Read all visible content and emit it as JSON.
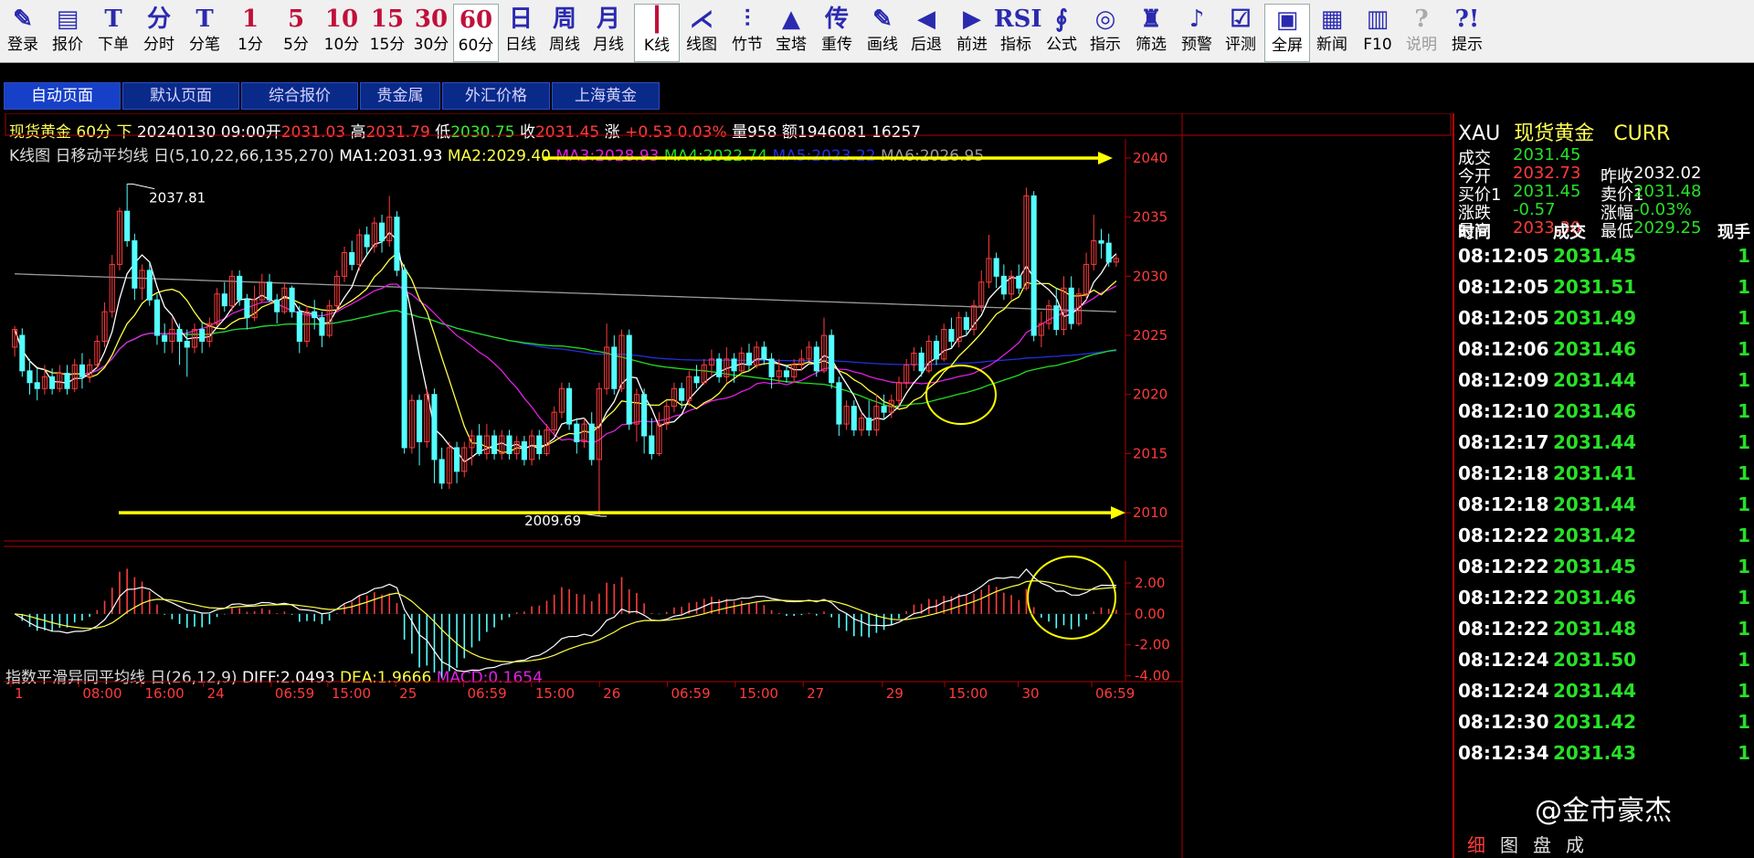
{
  "toolbar": [
    {
      "icon": "✎",
      "label": "登录",
      "name": "login"
    },
    {
      "icon": "▤",
      "label": "报价",
      "name": "quote"
    },
    {
      "icon": "T",
      "label": "下单",
      "name": "order"
    },
    {
      "icon": "分",
      "label": "分时",
      "name": "timeshare"
    },
    {
      "icon": "T",
      "label": "分笔",
      "name": "tick"
    },
    {
      "icon": "1",
      "label": "1分",
      "name": "1min"
    },
    {
      "icon": "5",
      "label": "5分",
      "name": "5min"
    },
    {
      "icon": "10",
      "label": "10分",
      "name": "10min"
    },
    {
      "icon": "15",
      "label": "15分",
      "name": "15min"
    },
    {
      "icon": "30",
      "label": "30分",
      "name": "30min"
    },
    {
      "icon": "60",
      "label": "60分",
      "name": "60min"
    },
    {
      "icon": "日",
      "label": "日线",
      "name": "daily"
    },
    {
      "icon": "周",
      "label": "周线",
      "name": "weekly"
    },
    {
      "icon": "月",
      "label": "月线",
      "name": "monthly"
    },
    {
      "icon": "┃",
      "label": "K线",
      "name": "kline"
    },
    {
      "icon": "⋌",
      "label": "线图",
      "name": "line"
    },
    {
      "icon": "⫶",
      "label": "竹节",
      "name": "bamboo"
    },
    {
      "icon": "▲",
      "label": "宝塔",
      "name": "tower"
    },
    {
      "icon": "传",
      "label": "重传",
      "name": "resend"
    },
    {
      "icon": "✎",
      "label": "画线",
      "name": "draw"
    },
    {
      "icon": "◀",
      "label": "后退",
      "name": "back"
    },
    {
      "icon": "▶",
      "label": "前进",
      "name": "forward"
    },
    {
      "icon": "RSI",
      "label": "指标",
      "name": "indicator"
    },
    {
      "icon": "∮",
      "label": "公式",
      "name": "formula"
    },
    {
      "icon": "◎",
      "label": "指示",
      "name": "indicate"
    },
    {
      "icon": "♜",
      "label": "筛选",
      "name": "filter"
    },
    {
      "icon": "♪",
      "label": "预警",
      "name": "alert"
    },
    {
      "icon": "☑",
      "label": "评测",
      "name": "evaluate"
    },
    {
      "icon": "▣",
      "label": "全屏",
      "name": "fullscreen"
    },
    {
      "icon": "▦",
      "label": "新闻",
      "name": "news"
    },
    {
      "icon": "▥",
      "label": "F10",
      "name": "f10"
    },
    {
      "icon": "?",
      "label": "说明",
      "name": "explain"
    },
    {
      "icon": "?!",
      "label": "提示",
      "name": "tips"
    }
  ],
  "tabs": [
    "自动页面",
    "默认页面",
    "综合报价",
    "贵金属",
    "外汇价格",
    "上海黄金"
  ],
  "header": {
    "name": "现货黄金",
    "period": "60分",
    "dir": "下",
    "date": "20240130 09:00",
    "open_label": "开",
    "open": "2031.03",
    "high_label": "高",
    "high": "2031.79",
    "low_label": "低",
    "low": "2030.75",
    "close_label": "收",
    "close": "2031.45",
    "chg_label": "涨",
    "chg": "+0.53",
    "pct": "0.03%",
    "vol_label": "量",
    "vol": "958",
    "amt_label": "额",
    "amt": "1946081",
    "oi": "16257"
  },
  "ma_bar": {
    "title": "K线图 日移动平均线 日(5,10,22,66,135,270)",
    "ma1": "MA1:2031.93",
    "ma2": "MA2:2029.40",
    "ma3": "MA3:2028.93",
    "ma4": "MA4:2022.74",
    "ma5": "MA5:2023.22",
    "ma6": "MA6:2026.95"
  },
  "macd_bar": {
    "title": "指数平滑异同平均线 日(26,12,9)",
    "diff": "DIFF:2.0493",
    "dea": "DEA:1.9666",
    "macd": "MACD:0.1654"
  },
  "colors": {
    "up": "#ff3b3b",
    "down": "#54ffff",
    "ma1": "#ffffff",
    "ma2": "#ffff44",
    "ma3": "#e020e0",
    "ma4": "#22dd22",
    "ma5": "#2030e0",
    "ma6": "#9a9a9a",
    "arrow": "#ffff00",
    "grid": "#b00000"
  },
  "chart_data": {
    "type": "candlestick",
    "y_ticks": [
      "2040",
      "2035",
      "2030",
      "2025",
      "2020",
      "2015",
      "2010"
    ],
    "ylim": [
      2008,
      2041
    ],
    "x_ticks": [
      "1",
      "08:00",
      "16:00",
      "24",
      "06:59",
      "15:00",
      "25",
      "06:59",
      "15:00",
      "26",
      "06:59",
      "15:00",
      "27",
      "29",
      "15:00",
      "30",
      "06:59"
    ],
    "macd_ticks": [
      "2.00",
      "0.00",
      "-2.00",
      "-4.00"
    ],
    "macd_ylim": [
      -4.2,
      3.3
    ],
    "annotations": {
      "high_marker": "2037.81",
      "low_marker": "2009.69",
      "arrow_levels": [
        2040,
        2010
      ]
    },
    "candles": [
      [
        2024,
        2025.5,
        2023.2,
        2025.8
      ],
      [
        2025,
        2022,
        2021.5,
        2025.6
      ],
      [
        2022,
        2021,
        2020,
        2023
      ],
      [
        2021,
        2020.5,
        2019.5,
        2022.2
      ],
      [
        2020.5,
        2021.5,
        2020,
        2022.5
      ],
      [
        2021.5,
        2020.5,
        2020,
        2022.2
      ],
      [
        2020.5,
        2021.8,
        2020.2,
        2022.5
      ],
      [
        2021.8,
        2020.5,
        2020,
        2022.5
      ],
      [
        2020.5,
        2022.5,
        2020.2,
        2023
      ],
      [
        2022.5,
        2021.5,
        2020.5,
        2023.5
      ],
      [
        2021.5,
        2022.5,
        2021,
        2023
      ],
      [
        2022.5,
        2024.5,
        2022.2,
        2025
      ],
      [
        2024.5,
        2027,
        2024,
        2027.8
      ],
      [
        2027,
        2031,
        2026.5,
        2031.8
      ],
      [
        2031,
        2035.5,
        2030.5,
        2035.8
      ],
      [
        2035.5,
        2033,
        2032.5,
        2037.8
      ],
      [
        2033,
        2029,
        2028,
        2033.6
      ],
      [
        2029,
        2030.5,
        2028,
        2031
      ],
      [
        2030.5,
        2028,
        2027.5,
        2031.2
      ],
      [
        2028,
        2025,
        2024.2,
        2028.5
      ],
      [
        2025,
        2024.5,
        2023.5,
        2026
      ],
      [
        2024.5,
        2025.5,
        2023.5,
        2026.5
      ],
      [
        2025.5,
        2024.5,
        2022.5,
        2026
      ],
      [
        2024.5,
        2024,
        2021.5,
        2025.5
      ],
      [
        2024,
        2025.5,
        2023.5,
        2026
      ],
      [
        2025.5,
        2024.5,
        2023.5,
        2026.2
      ],
      [
        2024.5,
        2026,
        2024,
        2026.5
      ],
      [
        2026,
        2028.5,
        2025.8,
        2029
      ],
      [
        2028.5,
        2027.5,
        2027,
        2029.5
      ],
      [
        2027.5,
        2030,
        2027,
        2030.5
      ],
      [
        2030,
        2028,
        2027.5,
        2030.5
      ],
      [
        2028,
        2026.5,
        2025.5,
        2028.5
      ],
      [
        2026.5,
        2028,
        2026.2,
        2029.2
      ],
      [
        2028,
        2029.5,
        2027.8,
        2030.2
      ],
      [
        2029.5,
        2028,
        2027.8,
        2030.2
      ],
      [
        2028,
        2027,
        2026,
        2028.5
      ],
      [
        2027,
        2029,
        2026.8,
        2029.5
      ],
      [
        2029,
        2027,
        2026.5,
        2029.2
      ],
      [
        2027,
        2024.5,
        2023.5,
        2027.5
      ],
      [
        2024.5,
        2027,
        2024,
        2027.5
      ],
      [
        2027,
        2026.5,
        2025.5,
        2028
      ],
      [
        2026.5,
        2025,
        2024,
        2027
      ],
      [
        2025,
        2027.5,
        2024.8,
        2028
      ],
      [
        2027.5,
        2030,
        2027,
        2030.5
      ],
      [
        2030,
        2032,
        2029.5,
        2032.5
      ],
      [
        2032,
        2031,
        2030.5,
        2033
      ],
      [
        2031,
        2033.5,
        2030.5,
        2034
      ],
      [
        2033.5,
        2032.5,
        2031.8,
        2034.2
      ],
      [
        2032.5,
        2034.5,
        2032,
        2035
      ],
      [
        2034.5,
        2033,
        2032,
        2035.2
      ],
      [
        2033,
        2035,
        2032.5,
        2036.8
      ],
      [
        2035,
        2030.5,
        2030,
        2035.5
      ],
      [
        2030.5,
        2015.5,
        2015,
        2031
      ],
      [
        2015.5,
        2019.5,
        2015,
        2020
      ],
      [
        2019.5,
        2016,
        2014,
        2020
      ],
      [
        2016,
        2020,
        2015.5,
        2020.5
      ],
      [
        2020,
        2014.5,
        2012.5,
        2020.5
      ],
      [
        2014.5,
        2012.5,
        2012,
        2015.5
      ],
      [
        2012.5,
        2015.5,
        2012,
        2016
      ],
      [
        2015.5,
        2013.5,
        2012.5,
        2016
      ],
      [
        2013.5,
        2015.5,
        2013,
        2016
      ],
      [
        2015.5,
        2016.5,
        2014,
        2017
      ],
      [
        2016.5,
        2015,
        2014.8,
        2017.5
      ],
      [
        2015,
        2016.5,
        2014.5,
        2017.5
      ],
      [
        2016.5,
        2015,
        2014.5,
        2017
      ],
      [
        2015,
        2016.5,
        2014.5,
        2017
      ],
      [
        2016.5,
        2015,
        2014.5,
        2017
      ],
      [
        2015,
        2016,
        2014.5,
        2016.5
      ],
      [
        2016,
        2014.5,
        2014,
        2016.5
      ],
      [
        2014.5,
        2016.5,
        2014,
        2017
      ],
      [
        2016.5,
        2015,
        2014.5,
        2017
      ],
      [
        2015,
        2017,
        2014.8,
        2017.5
      ],
      [
        2017,
        2018.5,
        2016.5,
        2019
      ],
      [
        2018.5,
        2020.5,
        2018,
        2021
      ],
      [
        2020.5,
        2017.5,
        2017,
        2021
      ],
      [
        2017.5,
        2016,
        2015,
        2018
      ],
      [
        2016,
        2017.5,
        2015.5,
        2018
      ],
      [
        2017.5,
        2014.5,
        2014,
        2018.5
      ],
      [
        2014.5,
        2020.5,
        2009.7,
        2021
      ],
      [
        2020.5,
        2024,
        2020,
        2026
      ],
      [
        2024,
        2020.5,
        2020,
        2025
      ],
      [
        2020.5,
        2025,
        2020.2,
        2025.5
      ],
      [
        2025,
        2017.5,
        2017,
        2025.5
      ],
      [
        2017.5,
        2020,
        2016,
        2020.5
      ],
      [
        2020,
        2016.5,
        2015,
        2020.5
      ],
      [
        2016.5,
        2015,
        2014.5,
        2018
      ],
      [
        2015,
        2017.5,
        2014.8,
        2018.5
      ],
      [
        2017.5,
        2019,
        2017,
        2019.5
      ],
      [
        2019,
        2020.5,
        2018.5,
        2021
      ],
      [
        2020.5,
        2019.5,
        2018.8,
        2021
      ],
      [
        2019.5,
        2021.5,
        2019,
        2022
      ],
      [
        2021.5,
        2021,
        2020.5,
        2022.5
      ],
      [
        2021,
        2022.5,
        2020.8,
        2023
      ],
      [
        2022.5,
        2023,
        2021.5,
        2023.8
      ],
      [
        2023,
        2021.5,
        2021,
        2023.5
      ],
      [
        2021.5,
        2023,
        2021,
        2024
      ],
      [
        2023,
        2022,
        2021,
        2023.5
      ],
      [
        2022,
        2023.5,
        2021.8,
        2024
      ],
      [
        2023.5,
        2022.5,
        2022,
        2024.3
      ],
      [
        2022.5,
        2024,
        2022.2,
        2024.5
      ],
      [
        2024,
        2023,
        2022.5,
        2024.5
      ],
      [
        2023,
        2021.5,
        2020.5,
        2023.5
      ],
      [
        2021.5,
        2022,
        2021,
        2023
      ],
      [
        2022,
        2021.5,
        2021,
        2022.5
      ],
      [
        2021.5,
        2022.5,
        2021,
        2023
      ],
      [
        2022.5,
        2023,
        2022,
        2023.8
      ],
      [
        2023,
        2024,
        2022.8,
        2024.5
      ],
      [
        2024,
        2022,
        2021.5,
        2024.5
      ],
      [
        2022,
        2025,
        2021.8,
        2026.5
      ],
      [
        2025,
        2021,
        2020.5,
        2025.5
      ],
      [
        2021,
        2017.5,
        2016.5,
        2021.5
      ],
      [
        2017.5,
        2019,
        2017,
        2019.5
      ],
      [
        2019,
        2017,
        2016.5,
        2019.5
      ],
      [
        2017,
        2018,
        2016.5,
        2018.5
      ],
      [
        2018,
        2017,
        2016.5,
        2019.5
      ],
      [
        2017,
        2019,
        2016.5,
        2020
      ],
      [
        2019,
        2018.5,
        2018,
        2020
      ],
      [
        2018.5,
        2019.5,
        2018,
        2020
      ],
      [
        2019.5,
        2021,
        2019,
        2021.5
      ],
      [
        2021,
        2022.5,
        2020.5,
        2023
      ],
      [
        2022.5,
        2023.5,
        2022,
        2024
      ],
      [
        2023.5,
        2022,
        2021.5,
        2024
      ],
      [
        2022,
        2024.5,
        2021.8,
        2025
      ],
      [
        2024.5,
        2023,
        2022.5,
        2025
      ],
      [
        2023,
        2025.5,
        2022.8,
        2026
      ],
      [
        2025.5,
        2024.5,
        2024,
        2026.5
      ],
      [
        2024.5,
        2026.5,
        2024,
        2027
      ],
      [
        2026.5,
        2025.5,
        2025,
        2027
      ],
      [
        2025.5,
        2027.5,
        2025,
        2028
      ],
      [
        2027.5,
        2029.5,
        2027,
        2030.5
      ],
      [
        2029.5,
        2031.5,
        2029,
        2033.5
      ],
      [
        2031.5,
        2030,
        2029,
        2032
      ],
      [
        2030,
        2028.5,
        2028,
        2031
      ],
      [
        2028.5,
        2030,
        2028,
        2030.5
      ],
      [
        2030,
        2029,
        2028.5,
        2031
      ],
      [
        2029,
        2036.8,
        2028.8,
        2037.5
      ],
      [
        2036.8,
        2025,
        2024.5,
        2037.2
      ],
      [
        2025,
        2026,
        2024,
        2027
      ],
      [
        2026,
        2027.5,
        2025.5,
        2028
      ],
      [
        2027.5,
        2025.5,
        2025,
        2029
      ],
      [
        2025.5,
        2029,
        2025,
        2030
      ],
      [
        2029,
        2026,
        2025.5,
        2030
      ],
      [
        2026,
        2028.5,
        2025.8,
        2029
      ],
      [
        2028.5,
        2031,
        2028,
        2032
      ],
      [
        2031,
        2033,
        2030.5,
        2035.2
      ],
      [
        2033,
        2032.8,
        2031.5,
        2034
      ],
      [
        2032.8,
        2031.2,
        2030.8,
        2033.6
      ],
      [
        2031.2,
        2031.5,
        2030.8,
        2031.8
      ]
    ]
  },
  "right_panel": {
    "symbol": "XAU",
    "name": "现货黄金",
    "currency": "CURR",
    "rows": [
      {
        "l1": "成交",
        "v1": "2031.45",
        "c1": "green",
        "l2": "",
        "v2": "",
        "c2": ""
      },
      {
        "l1": "今开",
        "v1": "2032.73",
        "c1": "red",
        "l2": "昨收",
        "v2": "2032.02",
        "c2": "white"
      },
      {
        "l1": "买价1",
        "v1": "2031.45",
        "c1": "green",
        "l2": "卖价1",
        "v2": "2031.48",
        "c2": "green"
      },
      {
        "l1": "涨跌",
        "v1": "-0.57",
        "c1": "green",
        "l2": "涨幅",
        "v2": "-0.03%",
        "c2": "green"
      },
      {
        "l1": "最高",
        "v1": "2033.30",
        "c1": "red",
        "l2": "最低",
        "v2": "2029.25",
        "c2": "green"
      }
    ],
    "tick_headers": [
      "时间",
      "成交",
      "现手"
    ],
    "ticks": [
      {
        "t": "08:12:05",
        "p": "2031.45",
        "v": "1"
      },
      {
        "t": "08:12:05",
        "p": "2031.51",
        "v": "1"
      },
      {
        "t": "08:12:05",
        "p": "2031.49",
        "v": "1"
      },
      {
        "t": "08:12:06",
        "p": "2031.46",
        "v": "1"
      },
      {
        "t": "08:12:09",
        "p": "2031.44",
        "v": "1"
      },
      {
        "t": "08:12:10",
        "p": "2031.46",
        "v": "1"
      },
      {
        "t": "08:12:17",
        "p": "2031.44",
        "v": "1"
      },
      {
        "t": "08:12:18",
        "p": "2031.41",
        "v": "1"
      },
      {
        "t": "08:12:18",
        "p": "2031.44",
        "v": "1"
      },
      {
        "t": "08:12:22",
        "p": "2031.42",
        "v": "1"
      },
      {
        "t": "08:12:22",
        "p": "2031.45",
        "v": "1"
      },
      {
        "t": "08:12:22",
        "p": "2031.46",
        "v": "1"
      },
      {
        "t": "08:12:22",
        "p": "2031.48",
        "v": "1"
      },
      {
        "t": "08:12:24",
        "p": "2031.50",
        "v": "1"
      },
      {
        "t": "08:12:24",
        "p": "2031.44",
        "v": "1"
      },
      {
        "t": "08:12:30",
        "p": "2031.42",
        "v": "1"
      },
      {
        "t": "08:12:34",
        "p": "2031.43",
        "v": "1"
      }
    ],
    "bottom_tabs": [
      "细",
      "图",
      "盘",
      "成"
    ]
  },
  "watermark": "@金市豪杰"
}
